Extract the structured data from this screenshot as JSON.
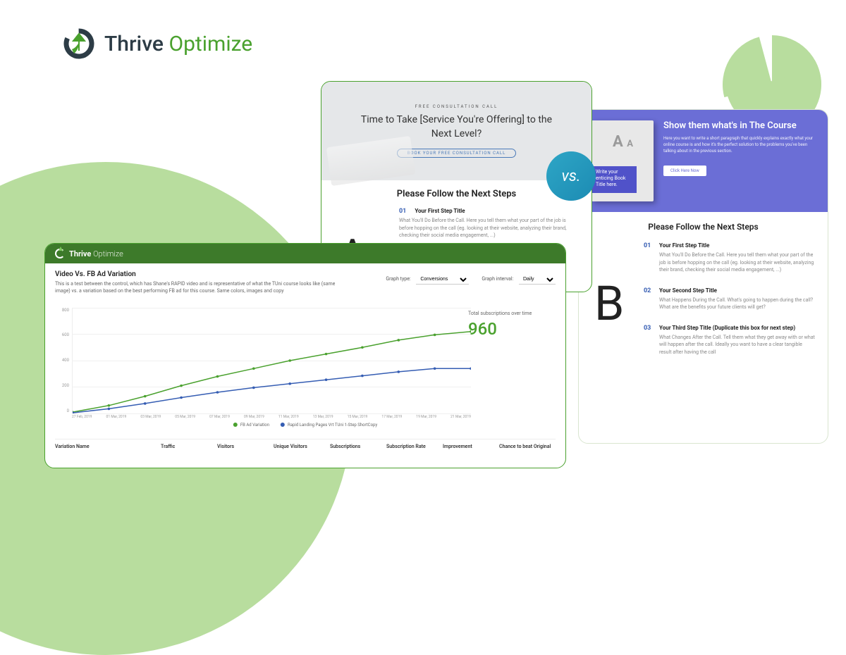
{
  "brand": {
    "name_bold": "Thrive",
    "name_accent": "Optimize"
  },
  "vs": "vs.",
  "cardA": {
    "letter": "A",
    "hero_tiny": "FREE CONSULTATION CALL",
    "hero_headline": "Time to Take [Service You're Offering] to the Next Level?",
    "hero_button": "BOOK YOUR FREE CONSULTATION CALL",
    "steps_title": "Please Follow the Next Steps",
    "step1_num": "01",
    "step1_title": "Your First Step Title",
    "step1_body": "What You'll Do Before the Call. Here you tell them what your part of the job is before hopping on the call (eg. looking at their website, analyzing their brand, checking their social media engagement, ...)"
  },
  "cardB": {
    "letter": "B",
    "hero_title": "Show them what's in The Course",
    "hero_body": "Here you want to write a short paragraph that quickly explains exactly what your online course is and how it's the perfect solution to the problems you've been talking about in the previous section.",
    "hero_button": "Click Here Now",
    "book_band": "Write your enticing Book Title here.",
    "steps_title": "Please Follow the Next Steps",
    "steps": [
      {
        "num": "01",
        "title": "Your First Step Title",
        "body": "What You'll Do Before the Call. Here you tell them what your part of the job is before hopping on the call (eg. looking at their website, analyzing their brand, checking their social media engagement, ...)"
      },
      {
        "num": "02",
        "title": "Your Second Step Title",
        "body": "What Happens During the Call. What's going to happen during the call? What are the benefits your future clients will get?"
      },
      {
        "num": "03",
        "title": "Your Third Step Title (Duplicate this box for next step)",
        "body": "What Changes After the Call. Tell them what they get away with or what will happen after the call. Ideally you want to have a clear tangible result after having the call"
      }
    ]
  },
  "dashboard": {
    "brand_bold": "Thrive",
    "brand_light": "Optimize",
    "title": "Video Vs. FB Ad Variation",
    "desc": "This is a test between the control, which has Shane's RAPID video and is representative of what the TUni course looks like (same image) vs. a variation based on the best performing FB ad for this course. Same colors, images and copy",
    "graph_type_label": "Graph type:",
    "graph_type_value": "Conversions",
    "graph_interval_label": "Graph interval:",
    "graph_interval_value": "Daily",
    "total_label": "Total subscriptions over time",
    "total_value": "960",
    "legend1": "FB Ad Variation",
    "legend2": "Rapid Landing Pages Vrt TUni 1-Step ShortCopy",
    "y_ticks": [
      "800",
      "600",
      "400",
      "200",
      "0"
    ],
    "x_ticks": [
      "27 Feb, 2019",
      "01 Mar, 2019",
      "03 Mar, 2019",
      "05 Mar, 2019",
      "07 Mar, 2019",
      "09 Mar, 2019",
      "11 Mar, 2019",
      "13 Mar, 2019",
      "15 Mar, 2019",
      "17 Mar, 2019",
      "19 Mar, 2019",
      "21 Mar, 2019"
    ],
    "table_headers": [
      "Variation Name",
      "Traffic",
      "Visitors",
      "Unique Visitors",
      "Subscriptions",
      "Subscription Rate",
      "Improvement",
      "Chance to beat Original"
    ]
  },
  "chart_data": {
    "type": "line",
    "title": "Total subscriptions over time",
    "xlabel": "",
    "ylabel": "Total subscriptions",
    "ylim": [
      0,
      800
    ],
    "x": [
      "27 Feb, 2019",
      "01 Mar, 2019",
      "03 Mar, 2019",
      "05 Mar, 2019",
      "07 Mar, 2019",
      "09 Mar, 2019",
      "11 Mar, 2019",
      "13 Mar, 2019",
      "15 Mar, 2019",
      "17 Mar, 2019",
      "19 Mar, 2019",
      "21 Mar, 2019"
    ],
    "series": [
      {
        "name": "FB Ad Variation",
        "color": "#4aa12e",
        "values": [
          10,
          60,
          130,
          210,
          280,
          340,
          400,
          450,
          500,
          555,
          595,
          620
        ]
      },
      {
        "name": "Rapid Landing Pages Vrt TUni 1-Step ShortCopy",
        "color": "#355db3",
        "values": [
          5,
          35,
          75,
          120,
          160,
          195,
          225,
          255,
          285,
          315,
          340,
          340
        ]
      }
    ]
  }
}
